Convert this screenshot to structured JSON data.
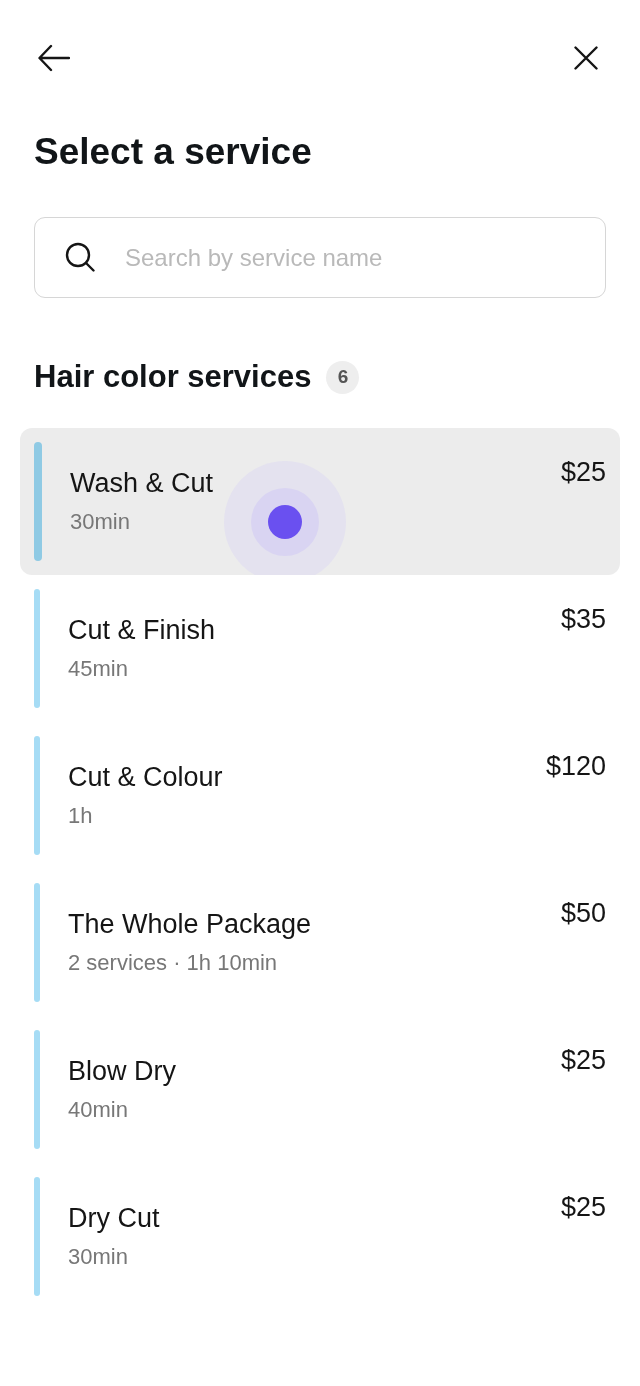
{
  "header": {
    "title": "Select a service"
  },
  "search": {
    "placeholder": "Search by service name"
  },
  "section": {
    "title": "Hair color services",
    "count": "6"
  },
  "services": [
    {
      "name": "Wash & Cut",
      "details": "30min",
      "price": "$25",
      "selected": true
    },
    {
      "name": "Cut & Finish",
      "details": "45min",
      "price": "$35",
      "selected": false
    },
    {
      "name": "Cut & Colour",
      "details": "1h",
      "price": "$120",
      "selected": false
    },
    {
      "name": "The Whole Package",
      "details": "2 services · 1h 10min",
      "price": "$50",
      "selected": false
    },
    {
      "name": "Blow Dry",
      "details": "40min",
      "price": "$25",
      "selected": false
    },
    {
      "name": "Dry Cut",
      "details": "30min",
      "price": "$25",
      "selected": false
    }
  ]
}
